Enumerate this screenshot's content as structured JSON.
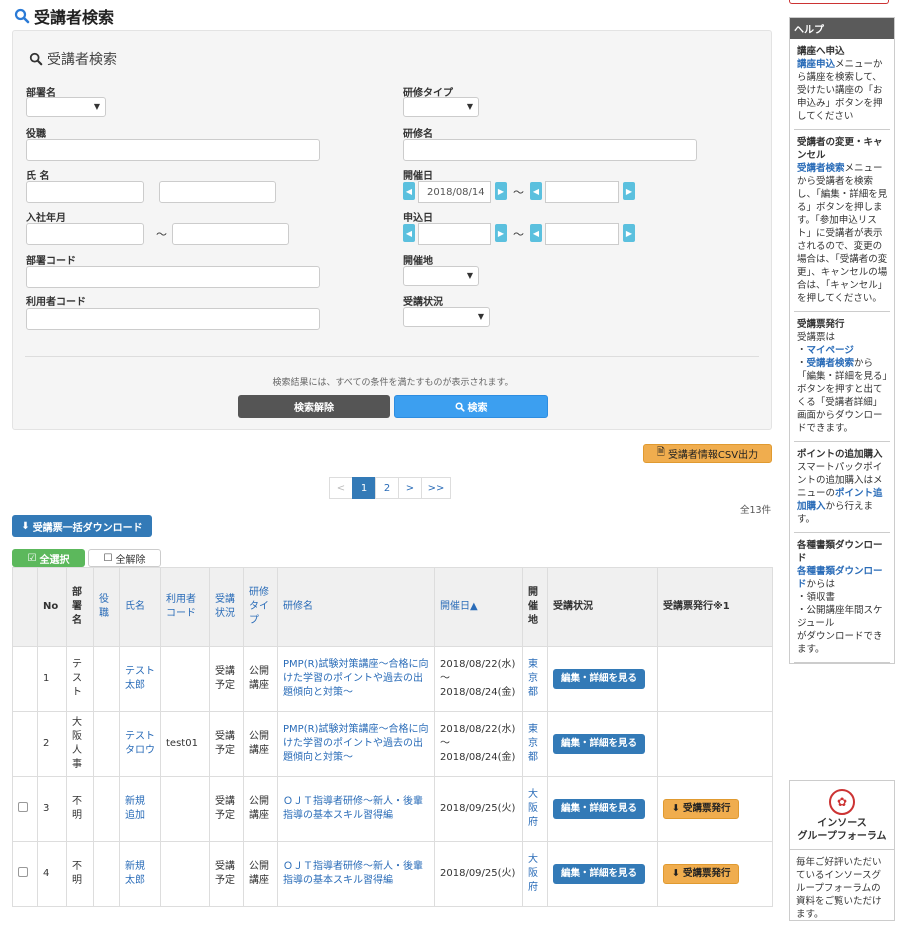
{
  "page_title": "受講者検索",
  "search_panel": {
    "title": "受講者検索",
    "labels": {
      "department": "部署名",
      "position": "役職",
      "name": "氏 名",
      "join_date": "入社年月",
      "department_code": "部署コード",
      "user_code": "利用者コード",
      "training_type": "研修タイプ",
      "training_name": "研修名",
      "held_date": "開催日",
      "apply_date": "申込日",
      "location": "開催地",
      "status": "受講状況"
    },
    "held_date_from": "2018/08/14",
    "tilde": "～",
    "note": "検索結果には、すべての条件を満たすものが表示されます。",
    "clear_button": "検索解除",
    "search_button": "検索"
  },
  "csv_button": "受講者情報CSV出力",
  "pagination": {
    "prev": "<",
    "pages": [
      "1",
      "2"
    ],
    "current": "1",
    "next": ">",
    "last": ">>"
  },
  "total_count": "全13件",
  "bulk_download_button": "受講票一括ダウンロード",
  "select_all_button": "全選択",
  "deselect_all_button": "全解除",
  "table": {
    "headers": {
      "no": "No",
      "department": "部署名",
      "position": "役職",
      "name": "氏名",
      "user_code": "利用者コード",
      "status": "受講状況",
      "training_type": "研修タイプ",
      "training_name": "研修名",
      "held_date": "開催日▲",
      "location": "開催地",
      "status2": "受講状況",
      "ticket": "受講票発行※1"
    },
    "rows": [
      {
        "no": "1",
        "department": "テスト",
        "name": "テスト 太郎",
        "user_code": "",
        "status": "受講予定",
        "type": "公開講座",
        "training": "PMP(R)試験対策講座～合格に向けた学習のポイントや過去の出題傾向と対策～",
        "date": "2018/08/22(水)～2018/08/24(金)",
        "location": "東京都",
        "edit": "編集・詳細を見る",
        "ticket": ""
      },
      {
        "no": "2",
        "department": "大阪人事",
        "name": "テスト タロウ",
        "user_code": "test01",
        "status": "受講予定",
        "type": "公開講座",
        "training": "PMP(R)試験対策講座～合格に向けた学習のポイントや過去の出題傾向と対策～",
        "date": "2018/08/22(水)～2018/08/24(金)",
        "location": "東京都",
        "edit": "編集・詳細を見る",
        "ticket": ""
      },
      {
        "no": "3",
        "department": "不明",
        "name": "新規 追加",
        "user_code": "",
        "status": "受講予定",
        "type": "公開講座",
        "training": "ＯＪＴ指導者研修～新人・後輩指導の基本スキル習得編",
        "date": "2018/09/25(火)",
        "location": "大阪府",
        "edit": "編集・詳細を見る",
        "ticket": "受講票発行"
      },
      {
        "no": "4",
        "department": "不明",
        "name": "新規 太郎",
        "user_code": "",
        "status": "受講予定",
        "type": "公開講座",
        "training": "ＯＪＴ指導者研修～新人・後輩指導の基本スキル習得編",
        "date": "2018/09/25(火)",
        "location": "大阪府",
        "edit": "編集・詳細を見る",
        "ticket": "受講票発行"
      }
    ]
  },
  "sidebar": {
    "head": "ヘルプ",
    "sections": [
      {
        "title": "講座へ申込",
        "link": "講座申込",
        "text": "メニューから講座を検索して、受けたい講座の「お申込み」ボタンを押してください"
      },
      {
        "title": "受講者の変更・キャンセル",
        "link": "受講者検索",
        "text": "メニューから受講者を検索し、「編集・詳細を見る」ボタンを押します。「参加申込リスト」に受講者が表示されるので、変更の場合は、「受講者の変更」、キャンセルの場合は、「キャンセル」を押してください。"
      },
      {
        "title": "受講票発行",
        "text_a": "受講票は",
        "link_a": "マイページ",
        "link_b": "受講者検索",
        "text_b": "から「編集・詳細を見る」ボタンを押すと出てくる「受講者詳細」画面からダウンロードできます。",
        "bullet": "・"
      },
      {
        "title": "ポイントの追加購入",
        "text_a": "スマートパックポイントの追加購入はメニューの",
        "link": "ポイント追加購入",
        "text_b": "から行えます。"
      },
      {
        "title": "各種書類ダウンロード",
        "link": "各種書類ダウンロード",
        "text_a": "からは",
        "items": [
          "・領収書",
          "・公開講座年間スケジュール"
        ],
        "text_b": "がダウンロードできます。"
      }
    ],
    "forum": {
      "name_line1": "インソース",
      "name_line2": "グループフォーラム",
      "desc": "毎年ご好評いただいているインソースグループフォーラムの資料をご覧いただけます。"
    }
  }
}
